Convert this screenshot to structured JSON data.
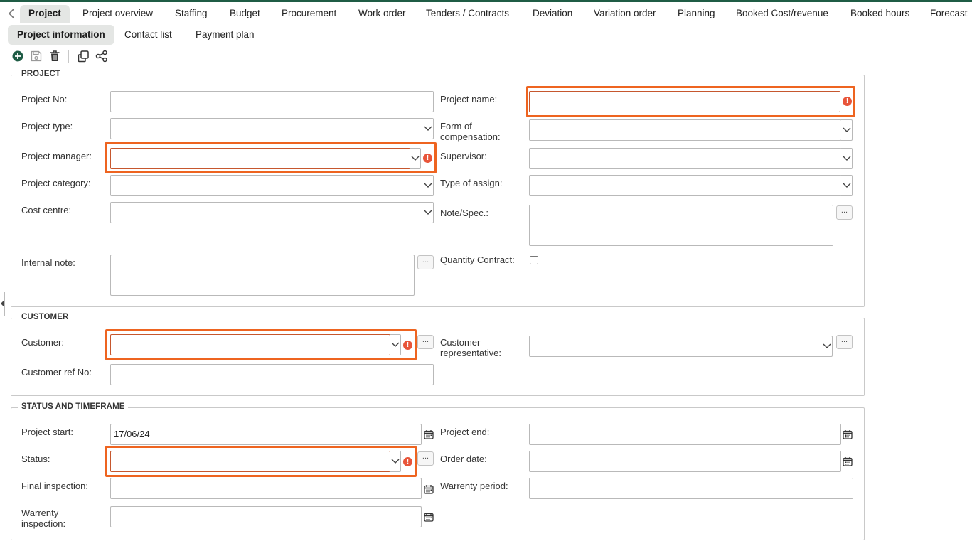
{
  "tabs": [
    "Project",
    "Project overview",
    "Staffing",
    "Budget",
    "Procurement",
    "Work order",
    "Tenders / Contracts",
    "Deviation",
    "Variation order",
    "Planning",
    "Booked Cost/revenue",
    "Booked hours",
    "Forecast"
  ],
  "subtabs": [
    "Project information",
    "Contact list",
    "Payment plan"
  ],
  "sections": {
    "project": "PROJECT",
    "customer": "CUSTOMER",
    "status": "STATUS AND TIMEFRAME"
  },
  "labels": {
    "project_no": "Project No:",
    "project_type": "Project type:",
    "project_manager": "Project manager:",
    "project_category": "Project category:",
    "cost_centre": "Cost centre:",
    "internal_note": "Internal note:",
    "project_name": "Project name:",
    "form_of_compensation_1": "Form of",
    "form_of_compensation_2": "compensation:",
    "supervisor": "Supervisor:",
    "type_of_assign": "Type of assign:",
    "note_spec": "Note/Spec.:",
    "quantity_contract": "Quantity Contract:",
    "customer": "Customer:",
    "customer_ref_no": "Customer ref No:",
    "customer_rep_1": "Customer",
    "customer_rep_2": "representative:",
    "project_start": "Project start:",
    "status": "Status:",
    "final_inspection": "Final inspection:",
    "warrenty_inspection_1": "Warrenty",
    "warrenty_inspection_2": "inspection:",
    "project_end": "Project end:",
    "order_date": "Order date:",
    "warrenty_period": "Warrenty period:"
  },
  "values": {
    "project_start": "17/06/24"
  },
  "ellipsis": "...",
  "warn_symbol": "!",
  "colors": {
    "accent": "#1f5c45",
    "required_border": "#ee6420",
    "warning": "#e8553a"
  },
  "icons": [
    "chevron-left-icon",
    "add-circle-icon",
    "save-icon",
    "trash-icon",
    "copy-icon",
    "share-icon",
    "calendar-icon",
    "warning-icon",
    "chevron-down-icon"
  ]
}
